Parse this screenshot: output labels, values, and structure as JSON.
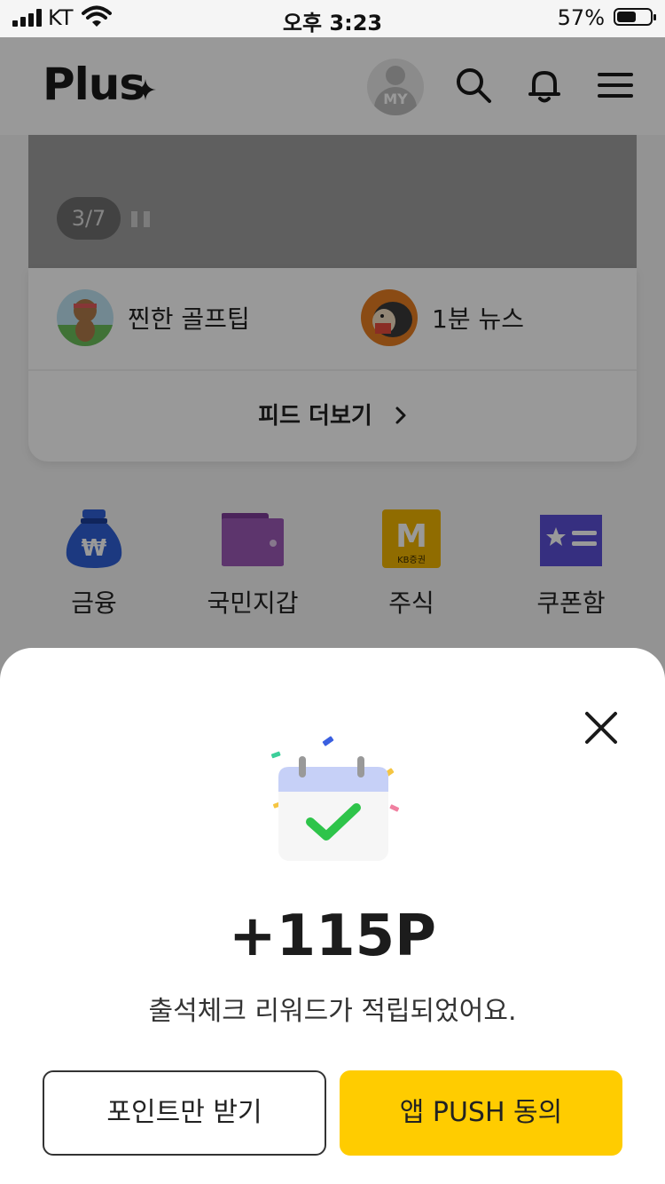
{
  "status_bar": {
    "carrier": "KT",
    "time": "오후 3:23",
    "battery_percent": "57%",
    "battery_level": 0.57
  },
  "header": {
    "logo": "Plus",
    "avatar_label": "MY",
    "icons": [
      "search-icon",
      "bell-icon",
      "menu-icon"
    ]
  },
  "banner": {
    "pager": "3/7"
  },
  "feed": {
    "items": [
      {
        "label": "찐한 골프팁",
        "icon": "golf-bear-icon"
      },
      {
        "label": "1분 뉴스",
        "icon": "hedgehog-news-icon"
      }
    ],
    "more_label": "피드 더보기",
    "more_icon": "chevron-right-icon"
  },
  "menu": [
    {
      "label": "금융",
      "icon": "money-bag-icon",
      "color": "#2f5fd6"
    },
    {
      "label": "국민지갑",
      "icon": "wallet-icon",
      "color": "#9b59b6"
    },
    {
      "label": "주식",
      "icon": "kb-stock-icon",
      "color": "#f0b400",
      "badge_letter": "M",
      "badge_sub": "KB증권"
    },
    {
      "label": "쿠폰함",
      "icon": "coupon-icon",
      "color": "#5b4fd6"
    }
  ],
  "sheet": {
    "points": "+115P",
    "message": "출석체크 리워드가 적립되었어요.",
    "secondary_button": "포인트만 받기",
    "primary_button": "앱 PUSH 동의",
    "accent": "#ffcc00"
  }
}
